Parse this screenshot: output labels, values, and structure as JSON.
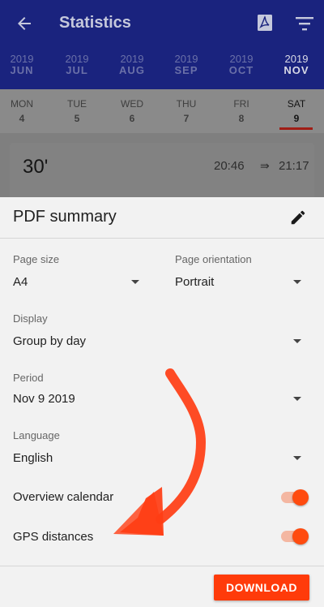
{
  "appbar": {
    "title": "Statistics",
    "back_icon": "arrow-back-icon",
    "pdf_icon": "pdf-icon",
    "filter_icon": "filter-icon"
  },
  "months": [
    {
      "year": "2019",
      "month": "JUN"
    },
    {
      "year": "2019",
      "month": "JUL"
    },
    {
      "year": "2019",
      "month": "AUG"
    },
    {
      "year": "2019",
      "month": "SEP"
    },
    {
      "year": "2019",
      "month": "OCT"
    },
    {
      "year": "2019",
      "month": "NOV"
    }
  ],
  "days": [
    {
      "name": "MON",
      "date": "4"
    },
    {
      "name": "TUE",
      "date": "5"
    },
    {
      "name": "WED",
      "date": "6"
    },
    {
      "name": "THU",
      "date": "7"
    },
    {
      "name": "FRI",
      "date": "8"
    },
    {
      "name": "SAT",
      "date": "9"
    }
  ],
  "card": {
    "duration": "30'",
    "start": "20:46",
    "arrow": "⇛",
    "end": "21:17"
  },
  "sheet": {
    "title": "PDF summary",
    "page_size": {
      "label": "Page size",
      "value": "A4"
    },
    "page_orientation": {
      "label": "Page orientation",
      "value": "Portrait"
    },
    "display": {
      "label": "Display",
      "value": "Group by day"
    },
    "period": {
      "label": "Period",
      "value": "Nov 9 2019"
    },
    "language": {
      "label": "Language",
      "value": "English"
    },
    "overview_calendar": {
      "label": "Overview calendar",
      "on": true
    },
    "gps_distances": {
      "label": "GPS distances",
      "on": true
    },
    "download_label": "DOWNLOAD"
  },
  "colors": {
    "appbar": "#1a237e",
    "accent": "#ff3b0a",
    "annotation": "#ff3d14"
  }
}
